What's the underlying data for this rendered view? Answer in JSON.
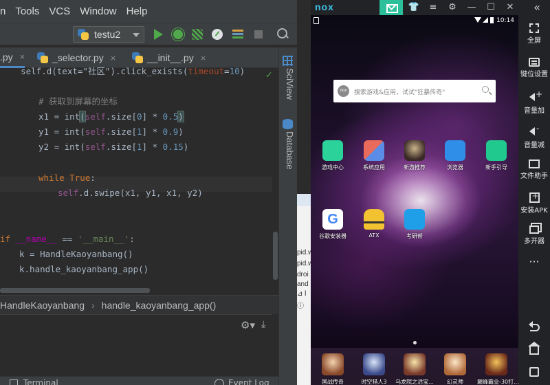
{
  "ide": {
    "menu": [
      "n",
      "Tools",
      "VCS",
      "Window",
      "Help"
    ],
    "run_config": "testu2",
    "tabs": [
      {
        "label": ".py",
        "close": "×"
      },
      {
        "label": "_selector.py",
        "close": "×"
      },
      {
        "label": "__init__.py",
        "close": "×"
      }
    ],
    "side_tabs": [
      "SciView",
      "Database"
    ],
    "breadcrumb": [
      "HandleKaoyanbang",
      "handle_kaoyanbang_app()"
    ],
    "breadcrumb_sep": "›",
    "toolwindow": [
      "Terminal",
      "Event Log"
    ],
    "gear": "⚙▾",
    "download": "⤓",
    "check": "✓",
    "code": {
      "l1_pre": "    self.d(text=\"社区\").click_exists(",
      "l1_param": "timeout",
      "l1_eq": "=",
      "l1_num": "10",
      "l1_end": ")",
      "l2_comment": "# 获取到屏幕的坐标",
      "x1_lhs": "x1 = int",
      "x1_open": "(",
      "x1_self": "self",
      "x1_mid": ".size[",
      "x1_idx": "0",
      "x1_op": "] * ",
      "x1_f": "0.5",
      "x1_close": ")",
      "y1_lhs": "y1 = int(",
      "y1_self": "self",
      "y1_mid": ".size[",
      "y1_idx": "1",
      "y1_op": "] * ",
      "y1_f": "0.9",
      "y1_close": ")",
      "y2_lhs": "y2 = int(",
      "y2_self": "self",
      "y2_mid": ".size[",
      "y2_idx": "1",
      "y2_op": "] * ",
      "y2_f": "0.15",
      "y2_close": ")",
      "while_kw": "while",
      "while_val": " True",
      "while_colon": ":",
      "swipe_self": "self",
      "swipe_rest": ".d.swipe(x1, y1, x1, y2)",
      "if_kw": "if",
      "if_name": " __name__",
      "if_eq": " == ",
      "if_str": "'__main__'",
      "if_colon": ":",
      "k_line": "k = HandleKaoyanbang()",
      "call_line": "k.handle_kaoyanbang_app()"
    }
  },
  "midwin": {
    "lines": [
      "pid.w",
      "pid.w",
      "droi",
      "and",
      "⊿ l",
      "ⓘ"
    ]
  },
  "nox": {
    "logo": "nox",
    "title_buttons": [
      "👕",
      "≡",
      "⚙",
      "—",
      "☐",
      "✕"
    ],
    "status_time": "10:14",
    "search_logo": "nox",
    "search_placeholder": "搜索游戏&应用，试试\"狂暴传奇\"",
    "apps_row1": [
      "游戏中心",
      "系统应用",
      "新游推荐",
      "浏览器",
      "新手引导"
    ],
    "apps_row2": [
      "谷歌安装器",
      "ATX",
      "考研帮"
    ],
    "dock": [
      "国战传奇",
      "时空猎人3",
      "乌龙院之活宝...",
      "幻灵师",
      "巅峰霸业-30打..."
    ],
    "side": [
      "全屏",
      "键位设置",
      "音量加",
      "音量减",
      "文件助手",
      "安装APK",
      "多开器",
      "···"
    ],
    "colors": {
      "accent": "#2bbf9b",
      "logo": "#3ec0e3"
    }
  }
}
